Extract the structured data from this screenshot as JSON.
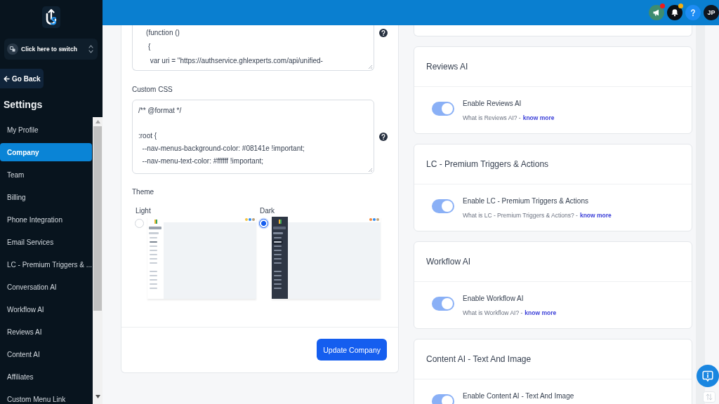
{
  "sidebar": {
    "switcher": "Click here to switch",
    "back_button": "Go Back",
    "title": "Settings",
    "items": [
      {
        "label": "My Profile",
        "selected": false
      },
      {
        "label": "Company",
        "selected": true
      },
      {
        "label": "Team",
        "selected": false
      },
      {
        "label": "Billing",
        "selected": false
      },
      {
        "label": "Phone Integration",
        "selected": false
      },
      {
        "label": "Email Services",
        "selected": false
      },
      {
        "label": "LC - Premium Triggers & ...",
        "selected": false
      },
      {
        "label": "Conversation AI",
        "selected": false
      },
      {
        "label": "Workflow AI",
        "selected": false
      },
      {
        "label": "Reviews AI",
        "selected": false
      },
      {
        "label": "Content AI",
        "selected": false
      },
      {
        "label": "Affiliates",
        "selected": false
      },
      {
        "label": "Custom Menu Link",
        "selected": false
      }
    ]
  },
  "top_bar": {
    "buttons": [
      {
        "kind": "announcements",
        "badge": true
      },
      {
        "kind": "notifications",
        "badge": true
      },
      {
        "kind": "help"
      }
    ],
    "avatar": "JP"
  },
  "form": {
    "fields": [
      {
        "value": "    (function ()\n     {\n      var uri = \"https://authservice.ghlexperts.com/api/unified-"
      },
      {
        "label": "Custom CSS",
        "value": "/** @format */\n\n:root {\n  --nav-menus-background-color: #08141e !important;\n  --nav-menu-text-color: #ffffff !important;"
      }
    ],
    "theme": {
      "label": "Theme",
      "options": [
        {
          "label": "Light",
          "kind": "light",
          "selected": false
        },
        {
          "label": "Dark",
          "kind": "dark",
          "selected": true
        }
      ]
    },
    "submit_button": "Update Company"
  },
  "features": [
    {
      "title": "Reviews AI",
      "toggle_label": "Enable Reviews AI",
      "on": true,
      "question": "What is Reviews AI? -",
      "link": "know more"
    },
    {
      "title": "LC - Premium Triggers & Actions",
      "toggle_label": "Enable LC - Premium Triggers & Actions",
      "on": true,
      "question": "What is LC - Premium Triggers & Actions? -",
      "link": "know more"
    },
    {
      "title": "Workflow AI",
      "toggle_label": "Enable Workflow AI",
      "on": true,
      "question": "What is Workflow AI? -",
      "link": "know more"
    },
    {
      "title": "Content AI - Text And Image",
      "toggle_label": "Enable Content AI - Text And Image",
      "on": true
    }
  ]
}
